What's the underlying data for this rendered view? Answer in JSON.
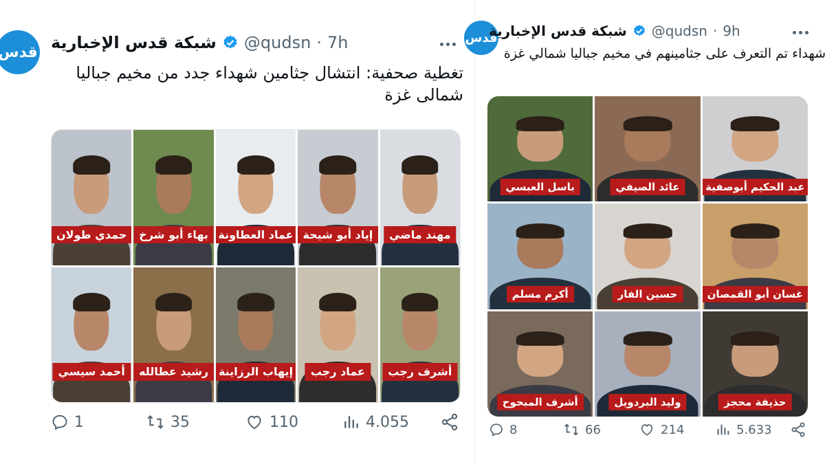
{
  "tweets": [
    {
      "avatar_text": "قدس",
      "name": "شبكة قدس الإخبارية",
      "handle": "@qudsn",
      "separator": "·",
      "time": "7h",
      "text": "تغطية صحفية: انتشال جثامين شهداء جدد من مخيم جباليا شمالى غزة",
      "images": [
        {
          "label": "مهند ماضي",
          "bg": "#d9dde2"
        },
        {
          "label": "إياد أبو شيحة",
          "bg": "#c7ccd3"
        },
        {
          "label": "عماد العطاونة",
          "bg": "#e9ecef"
        },
        {
          "label": "بهاء أبو شرخ",
          "bg": "#6f8a4e"
        },
        {
          "label": "حمدي طولان",
          "bg": "#bcc3cb"
        },
        {
          "label": "أشرف رجب",
          "bg": "#9aa27a"
        },
        {
          "label": "عماد رجب",
          "bg": "#c9c2b0"
        },
        {
          "label": "إيهاب الرزاينة",
          "bg": "#7c7a6a"
        },
        {
          "label": "رشيد عطالله",
          "bg": "#8a6f4a"
        },
        {
          "label": "أحمد سيسي",
          "bg": "#c9d3dc"
        }
      ],
      "stats": {
        "replies": "1",
        "retweets": "35",
        "likes": "110",
        "views": "4.055"
      }
    },
    {
      "avatar_text": "قدس",
      "name": "شبكة قدس الإخبارية",
      "handle": "@qudsn",
      "separator": "·",
      "time": "9h",
      "text": "شهداء تم التعرف على جثامينهم في مخيم جباليا شمالي غزة",
      "images": [
        {
          "label": "عبد الحكيم أبوصفية",
          "bg": "#cfcfd1"
        },
        {
          "label": "عائد الصيفي",
          "bg": "#8b6a55"
        },
        {
          "label": "باسل العبسي",
          "bg": "#4f6b3b"
        },
        {
          "label": "غسان أبو القمصان",
          "bg": "#c9a06a"
        },
        {
          "label": "حسين الفار",
          "bg": "#d8d4cf"
        },
        {
          "label": "أكرم مسلم",
          "bg": "#9bb3c6"
        },
        {
          "label": "حذيفة محجز",
          "bg": "#3f3a34"
        },
        {
          "label": "وليد البردويل",
          "bg": "#a7b0bc"
        },
        {
          "label": "أشرف المبحوح",
          "bg": "#7a6a5c"
        }
      ],
      "stats": {
        "replies": "8",
        "retweets": "66",
        "likes": "214",
        "views": "5.633"
      }
    }
  ],
  "colors": {
    "label_bg": "#b81b1b",
    "verified": "#1d9bf0",
    "avatar": "#1d8fd9",
    "muted": "#536471"
  },
  "icons": [
    "verified-badge-icon",
    "more-icon",
    "reply-icon",
    "retweet-icon",
    "like-icon",
    "views-icon",
    "share-icon"
  ]
}
